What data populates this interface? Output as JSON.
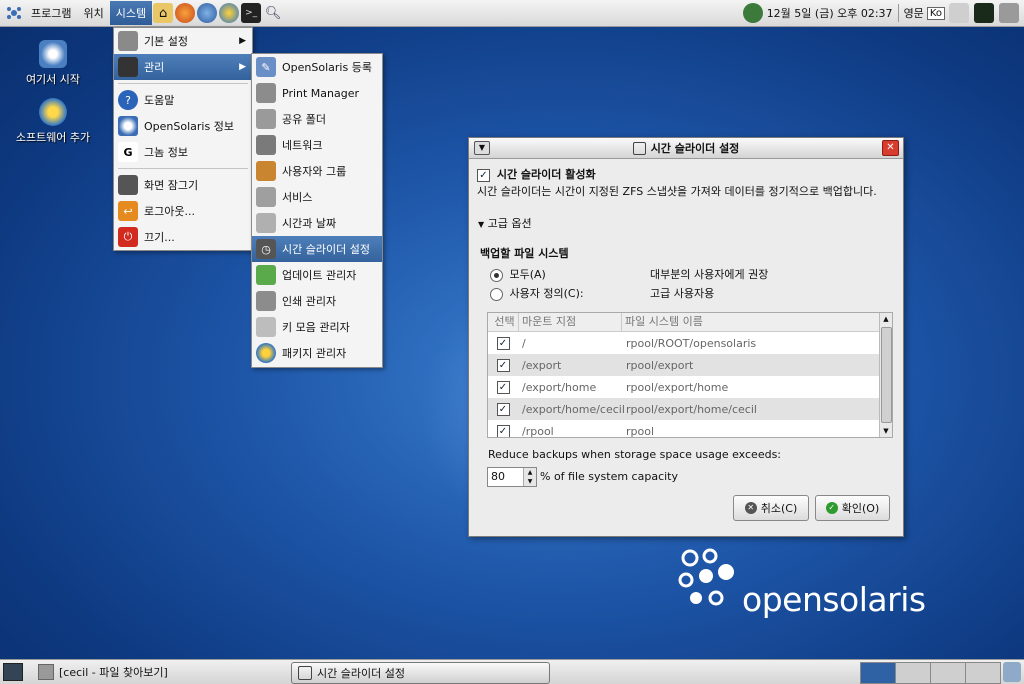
{
  "top_panel": {
    "menus": [
      "프로그램",
      "위치",
      "시스템"
    ],
    "clock": "12월  5일 (금) 오후 02:37",
    "keyboard": "영문",
    "ime": "Ko"
  },
  "desktop_icons": [
    "여기서 시작",
    "소프트웨어 추가"
  ],
  "system_menu": {
    "items": [
      "기본 설정",
      "관리",
      "도움말",
      "OpenSolaris 정보",
      "그놈 정보",
      "화면 잠그기",
      "로그아웃...",
      "끄기..."
    ]
  },
  "admin_menu": {
    "items": [
      "OpenSolaris 등록",
      "Print Manager",
      "공유 폴더",
      "네트워크",
      "사용자와 그룹",
      "서비스",
      "시간과 날짜",
      "시간 슬라이더 설정",
      "업데이트 관리자",
      "인쇄 관리자",
      "키 모음 관리자",
      "패키지 관리자"
    ]
  },
  "dialog": {
    "title": "시간 슬라이더 설정",
    "enable_label": "시간 슬라이더 활성화",
    "description": "시간 슬라이더는 시간이 지정된 ZFS 스냅샷을 가져와 데이터를 정기적으로 백업합니다.",
    "advanced": "고급 옵션",
    "fs_heading": "백업할 파일 시스템",
    "radio_all": "모두(A)",
    "radio_all_hint": "대부분의 사용자에게 권장",
    "radio_custom": "사용자 정의(C):",
    "radio_custom_hint": "고급 사용자용",
    "columns": [
      "선택",
      "마운트 지점",
      "파일 시스템 이름"
    ],
    "rows": [
      {
        "mount": "/",
        "fs": "rpool/ROOT/opensolaris"
      },
      {
        "mount": "/export",
        "fs": "rpool/export"
      },
      {
        "mount": "/export/home",
        "fs": "rpool/export/home"
      },
      {
        "mount": "/export/home/cecil",
        "fs": "rpool/export/home/cecil"
      },
      {
        "mount": "/rpool",
        "fs": "rpool"
      }
    ],
    "reduce_label": "Reduce backups when storage space usage exceeds:",
    "percent_value": "80",
    "percent_suffix": "% of file system capacity",
    "cancel": "취소(C)",
    "ok": "확인(O)"
  },
  "brand": "opensolaris",
  "taskbar": {
    "tasks": [
      "[cecil - 파일 찾아보기]",
      "시간 슬라이더 설정"
    ]
  },
  "colors": {
    "desktop": "#1e56a8",
    "highlight": "#3f6ea9",
    "close": "#d73c2c"
  }
}
